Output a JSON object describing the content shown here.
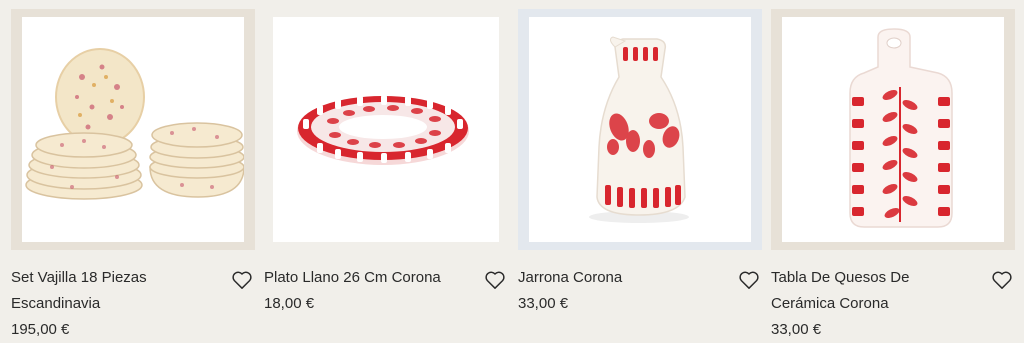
{
  "products": [
    {
      "title": "Set Vajilla 18 Piezas Escandinavia",
      "price": "195,00 €",
      "image": "dinnerware-set-image",
      "wishlist_icon": "heart-icon"
    },
    {
      "title": "Plato Llano 26 Cm Corona",
      "price": "18,00 €",
      "image": "plate-image",
      "wishlist_icon": "heart-icon"
    },
    {
      "title": "Jarrona Corona",
      "price": "33,00 €",
      "image": "jug-image",
      "wishlist_icon": "heart-icon"
    },
    {
      "title": "Tabla De Quesos De Cerámica Corona",
      "price": "33,00 €",
      "image": "cheese-board-image",
      "wishlist_icon": "heart-icon"
    }
  ],
  "colors": {
    "page_bg": "#f1efea",
    "accent_red": "#d8262e",
    "text": "#2a2a2a"
  }
}
